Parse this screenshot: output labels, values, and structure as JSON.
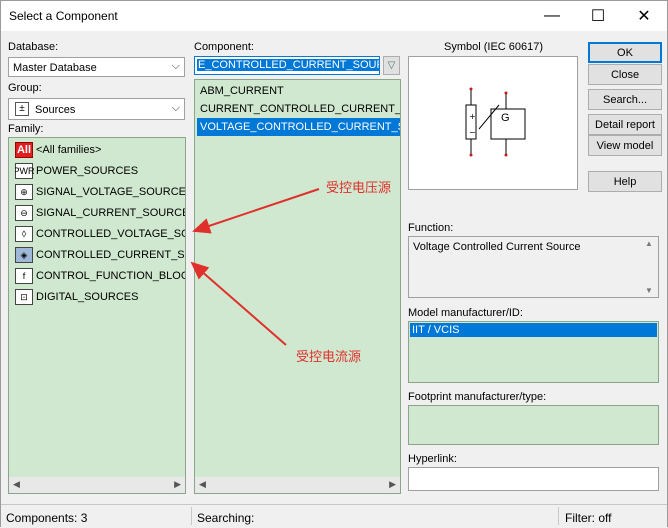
{
  "window": {
    "title": "Select a Component",
    "minimize_glyph": "—",
    "maximize_glyph": "☐",
    "close_glyph": "✕"
  },
  "database": {
    "label": "Database:",
    "value": "Master Database"
  },
  "group": {
    "label": "Group:",
    "value": "Sources",
    "icon": "sources-icon"
  },
  "family": {
    "label": "Family:",
    "items": [
      {
        "label": "<All families>",
        "icon_text": "All"
      },
      {
        "label": "POWER_SOURCES",
        "icon_text": "PWR"
      },
      {
        "label": "SIGNAL_VOLTAGE_SOURCES",
        "icon_text": "⊕"
      },
      {
        "label": "SIGNAL_CURRENT_SOURCES",
        "icon_text": "⊖"
      },
      {
        "label": "CONTROLLED_VOLTAGE_SOURCES",
        "icon_text": "◊"
      },
      {
        "label": "CONTROLLED_CURRENT_SOURCES",
        "icon_text": "◈"
      },
      {
        "label": "CONTROL_FUNCTION_BLOCKS",
        "icon_text": "f"
      },
      {
        "label": "DIGITAL_SOURCES",
        "icon_text": "⊡"
      }
    ]
  },
  "component": {
    "label": "Component:",
    "search_value": "E_CONTROLLED_CURRENT_SOURCE",
    "items": [
      "ABM_CURRENT",
      "CURRENT_CONTROLLED_CURRENT_SOURCE",
      "VOLTAGE_CONTROLLED_CURRENT_SOURCE"
    ],
    "selected_index": 2
  },
  "symbol": {
    "label": "Symbol (IEC 60617)",
    "glyph_letter": "G"
  },
  "buttons": {
    "ok": "OK",
    "close": "Close",
    "search": "Search...",
    "detail_report": "Detail report",
    "view_model": "View model",
    "help": "Help"
  },
  "function": {
    "label": "Function:",
    "value": "Voltage Controlled Current Source"
  },
  "model": {
    "label": "Model manufacturer/ID:",
    "value": "IIT / VCIS"
  },
  "footprint": {
    "label": "Footprint manufacturer/type:"
  },
  "hyperlink": {
    "label": "Hyperlink:",
    "value": ""
  },
  "status": {
    "components": "Components: 3",
    "searching": "Searching:",
    "filter": "Filter: off"
  },
  "annotations": {
    "voltage": "受控电压源",
    "current": "受控电流源"
  },
  "colors": {
    "list_bg": "#cfe8cf",
    "selection": "#0078d7",
    "annotation": "#e0302c"
  }
}
